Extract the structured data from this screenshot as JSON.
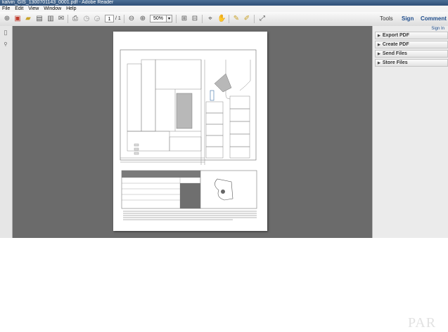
{
  "window": {
    "title": "kalvin_GIS_1300701143_0001.pdf - Adobe Reader"
  },
  "menu": [
    "File",
    "Edit",
    "View",
    "Window",
    "Help"
  ],
  "toolbar": {
    "page_current": "1",
    "page_total": "/ 1",
    "zoom": "50%",
    "tools_label": "Tools",
    "sign_label": "Sign",
    "comment_label": "Comment"
  },
  "right_panel": {
    "sign_in": "Sign In",
    "panes": [
      "Export PDF",
      "Create PDF",
      "Send Files",
      "Store Files"
    ]
  },
  "watermark": "PAR",
  "colors": {
    "doc_background": "#6b6b6b",
    "accent": "#1f4d8c"
  }
}
